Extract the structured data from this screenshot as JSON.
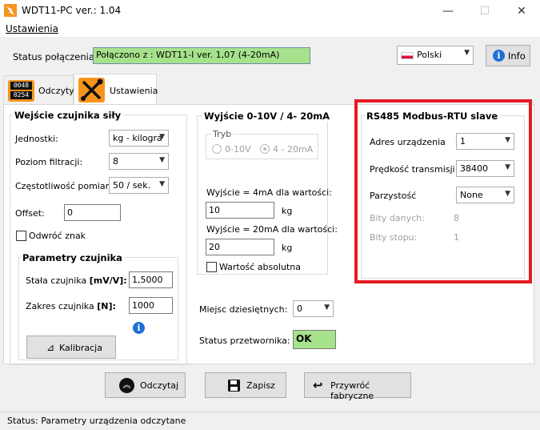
{
  "window": {
    "title": "WDT11-PC  ver.: 1.04",
    "minimize": "—",
    "maximize": "☐",
    "close": "✕"
  },
  "menu": {
    "settings": "Ustawienia"
  },
  "connection": {
    "label": "Status połączenia",
    "value": "Połączono z : WDT11-I ver. 1,07 (4-20mA)",
    "status_color": "#a6e28c"
  },
  "language": {
    "selected": "Polski",
    "flag_icon": "poland-flag-icon"
  },
  "info_button": {
    "label": "Info",
    "icon": "info-icon"
  },
  "tabs": [
    {
      "label": "Odczyty",
      "icon": "display-0048-0254-icon",
      "display_top": "0048",
      "display_bottom": "0254"
    },
    {
      "label": "Ustawienia",
      "icon": "wrench-screwdriver-icon",
      "active": true
    }
  ],
  "sensor_input": {
    "title": "Wejście czujnika siły",
    "units_label": "Jednostki:",
    "units_value": "kg - kilogra",
    "filter_label": "Poziom filtracji:",
    "filter_value": "8",
    "freq_label": "Częstotliwość pomiaru:",
    "freq_value": "50  / sek.",
    "offset_label": "Offset:",
    "offset_value": "0",
    "invert_label": "Odwróć znak",
    "params": {
      "title": "Parametry czujnika",
      "constant_label": "Stała czujnika",
      "constant_unit": "[mV/V]:",
      "constant_value": "1,5000",
      "range_label": "Zakres czujnika",
      "range_unit": "[N]:",
      "range_value": "1000",
      "calibrate_label": "Kalibracja"
    }
  },
  "output": {
    "title": "Wyjście 0-10V / 4- 20mA",
    "mode_title": "Tryb",
    "mode_options": [
      "0-10V",
      "4 - 20mA"
    ],
    "mode_selected": "4 - 20mA",
    "out4_label": "Wyjście = 4mA dla wartości:",
    "out4_value": "10",
    "out4_unit": "kg",
    "out20_label": "Wyjście = 20mA dla wartości:",
    "out20_value": "20",
    "out20_unit": "kg",
    "absolute_label": "Wartość absolutna"
  },
  "decimal": {
    "label": "Miejsc dziesiętnych:",
    "value": "0"
  },
  "converter": {
    "label": "Status przetwornika:",
    "value": "OK"
  },
  "modbus": {
    "title": "RS485 Modbus-RTU slave",
    "address_label": "Adres urządzenia",
    "address_value": "1",
    "baud_label": "Prędkość transmisji",
    "baud_value": "38400",
    "parity_label": "Parzystość",
    "parity_value": "None",
    "databits_label": "Bity danych:",
    "databits_value": "8",
    "stopbits_label": "Bity stopu:",
    "stopbits_value": "1",
    "highlight_color": "#e31b23"
  },
  "actions": {
    "read_label": "Odczytaj",
    "save_label": "Zapisz",
    "restore_label": "Przywróć fabryczne"
  },
  "statusbar": {
    "text": "Status:  Parametry urządzenia odczytane"
  }
}
